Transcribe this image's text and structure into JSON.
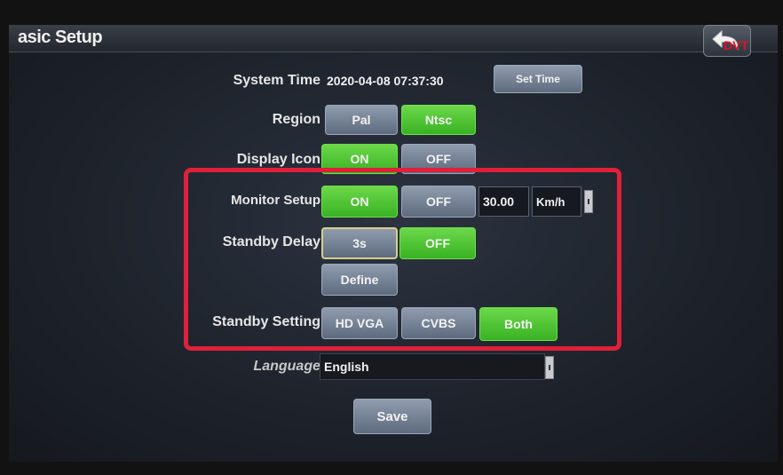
{
  "header": {
    "title": "asic Setup",
    "back_badge": "DVT"
  },
  "system_time": {
    "label": "System Time",
    "value": "2020-04-08 07:37:30",
    "set_button": "Set Time"
  },
  "region": {
    "label": "Region",
    "options": [
      "Pal",
      "Ntsc"
    ],
    "selected": "Ntsc"
  },
  "display_icon": {
    "label": "Display Icon",
    "on": "ON",
    "off": "OFF",
    "selected": "ON"
  },
  "monitor_setup": {
    "label": "Monitor Setup",
    "on": "ON",
    "off": "OFF",
    "selected": "ON",
    "speed": "30.00",
    "unit": "Km/h"
  },
  "standby_delay": {
    "label": "Standby Delay",
    "value": "3s",
    "off": "OFF",
    "define": "Define",
    "selected": "OFF"
  },
  "standby_setting": {
    "label": "Standby Setting",
    "options": [
      "HD VGA",
      "CVBS",
      "Both"
    ],
    "selected": "Both"
  },
  "language": {
    "label": "Language",
    "value": "English"
  },
  "save_button": "Save",
  "colors": {
    "on_green": "#4cc434",
    "off_gray": "#7a879a",
    "highlight_red": "#e0203a"
  }
}
